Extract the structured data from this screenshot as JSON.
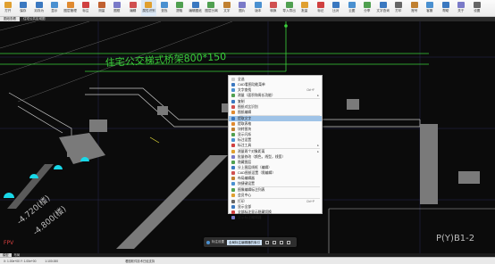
{
  "ribbon": {
    "buttons": [
      {
        "label": "打开",
        "icon": "open-folder-icon",
        "color": "#e0a030"
      },
      {
        "label": "保存",
        "icon": "save-icon",
        "color": "#3a78c0"
      },
      {
        "label": "另存为",
        "icon": "save-as-icon",
        "color": "#3a78c0"
      },
      {
        "label": "显示",
        "icon": "display-icon",
        "color": "#4a90d0"
      },
      {
        "label": "图层管理",
        "icon": "layer-icon",
        "color": "#e08a30"
      },
      {
        "label": "标注",
        "icon": "dimension-icon",
        "color": "#d04040"
      },
      {
        "label": "测量",
        "icon": "measure-icon",
        "color": "#c06030"
      },
      {
        "label": "图框",
        "icon": "frame-icon",
        "color": "#7a7ac8"
      },
      {
        "label": "编辑",
        "icon": "edit-icon",
        "color": "#d05050"
      },
      {
        "label": "属性识别",
        "icon": "property-icon",
        "color": "#e0a030"
      },
      {
        "label": "查找",
        "icon": "find-icon",
        "color": "#4a90d0"
      },
      {
        "label": "提取",
        "icon": "extract-icon",
        "color": "#50a050"
      },
      {
        "label": "编辑图纸",
        "icon": "edit-drawing-icon",
        "color": "#3a78c0"
      },
      {
        "label": "图层分离",
        "icon": "layer-split-icon",
        "color": "#50a050"
      },
      {
        "label": "文字",
        "icon": "text-icon",
        "color": "#c08030"
      },
      {
        "label": "图片",
        "icon": "image-icon",
        "color": "#7a7ac8"
      },
      {
        "label": "版本",
        "icon": "version-icon",
        "color": "#4a90d0"
      },
      {
        "label": "转换",
        "icon": "convert-icon",
        "color": "#d05050"
      },
      {
        "label": "导入导出",
        "icon": "import-export-icon",
        "color": "#50a050"
      },
      {
        "label": "批量",
        "icon": "batch-icon",
        "color": "#e0a030"
      },
      {
        "label": "标记",
        "icon": "mark-icon",
        "color": "#d04040"
      },
      {
        "label": "比对",
        "icon": "compare-icon",
        "color": "#3a78c0"
      },
      {
        "label": "云图",
        "icon": "cloud-icon",
        "color": "#4a90d0"
      },
      {
        "label": "分享",
        "icon": "share-icon",
        "color": "#50a050"
      },
      {
        "label": "文字查询",
        "icon": "text-search-icon",
        "color": "#3a78c0"
      },
      {
        "label": "打印",
        "icon": "print-icon",
        "color": "#666666"
      },
      {
        "label": "账号",
        "icon": "account-icon",
        "color": "#c08030"
      },
      {
        "label": "客服",
        "icon": "support-icon",
        "color": "#4a90d0"
      },
      {
        "label": "帮助",
        "icon": "help-icon",
        "color": "#3a78c0"
      },
      {
        "label": "关于",
        "icon": "about-icon",
        "color": "#7a7ac8"
      },
      {
        "label": "设置",
        "icon": "settings-icon",
        "color": "#666666"
      }
    ]
  },
  "tabs": [
    "图纸查看",
    "住宅公共区域图"
  ],
  "canvas": {
    "beam_label": "住宅公交梯式桥架800*150",
    "elevation_1": "-4.720(楼)",
    "elevation_2": "-4.800(楼)",
    "axis_label": "P(Y)B1-2",
    "bottom_text": "FPV"
  },
  "context_menu": {
    "items": [
      {
        "label": "全选",
        "shortcut": "",
        "icon_color": "#cccccc",
        "submenu": false
      },
      {
        "label": "CAD看图功能菜单",
        "shortcut": "",
        "icon_color": "#3a78c0",
        "submenu": false
      },
      {
        "label": "文字查找",
        "shortcut": "Ctrl+F",
        "icon_color": "#4a90d0",
        "submenu": false
      },
      {
        "label": "测量（面积和周长功能）",
        "shortcut": "",
        "icon_color": "#50a050",
        "submenu": true
      },
      {
        "label": "复制",
        "shortcut": "",
        "icon_color": "#3a78c0",
        "submenu": false
      },
      {
        "label": "图纸对比识别",
        "shortcut": "",
        "icon_color": "#d05050",
        "submenu": false
      },
      {
        "label": "图纸编辑",
        "shortcut": "",
        "icon_color": "#e08a30",
        "submenu": false
      },
      {
        "label": "提取文字",
        "shortcut": "",
        "icon_color": "#3a78c0",
        "submenu": false,
        "highlighted": true
      },
      {
        "label": "提取表格",
        "shortcut": "",
        "icon_color": "#e08a30",
        "submenu": false
      },
      {
        "label": "块转图块",
        "shortcut": "",
        "icon_color": "#c08030",
        "submenu": false
      },
      {
        "label": "显示闪烁",
        "shortcut": "",
        "icon_color": "#50a050",
        "submenu": false
      },
      {
        "label": "标注设置",
        "shortcut": "",
        "icon_color": "#4a90d0",
        "submenu": false
      },
      {
        "label": "标注工具",
        "shortcut": "",
        "icon_color": "#d04040",
        "submenu": true
      },
      {
        "label": "测量两个对象距离",
        "shortcut": "",
        "icon_color": "#e0a030",
        "submenu": true
      },
      {
        "label": "批量修改（颜色，线型，线宽）",
        "shortcut": "",
        "icon_color": "#7a7ac8",
        "submenu": false
      },
      {
        "label": "隐藏图层",
        "shortcut": "",
        "icon_color": "#50a050",
        "submenu": false
      },
      {
        "label": "分上图层线框（编辑）",
        "shortcut": "",
        "icon_color": "#3a78c0",
        "submenu": false
      },
      {
        "label": "CAD图纸设置（需编辑）",
        "shortcut": "",
        "icon_color": "#d05050",
        "submenu": false
      },
      {
        "label": "布局编辑器",
        "shortcut": "",
        "icon_color": "#c08030",
        "submenu": false
      },
      {
        "label": "快捷键设置",
        "shortcut": "",
        "icon_color": "#4a90d0",
        "submenu": false
      },
      {
        "label": "图像编辑标注列表",
        "shortcut": "",
        "icon_color": "#50a050",
        "submenu": false,
        "checked": true
      },
      {
        "label": "会员中心",
        "shortcut": "",
        "icon_color": "#e0a030",
        "submenu": false
      },
      {
        "label": "打印",
        "shortcut": "Ctrl+P",
        "icon_color": "#666666",
        "submenu": false
      },
      {
        "label": "显示全部",
        "shortcut": "",
        "icon_color": "#3a78c0",
        "submenu": false
      },
      {
        "label": "全部标注显示隐藏切换",
        "shortcut": "",
        "icon_color": "#d04040",
        "submenu": false
      },
      {
        "label": "显示标注编辑器",
        "shortcut": "",
        "icon_color": "#7a7ac8",
        "submenu": false
      }
    ],
    "separators_after": [
      3,
      6,
      12,
      19,
      21
    ]
  },
  "floatbar": {
    "label": "标注设置",
    "dropdown": "全局标注编辑器的索引"
  },
  "model_tabs": [
    "模型",
    "布局"
  ],
  "status": {
    "coords": "X: 1.00e+00  Y: 1.00e+00",
    "scale": "1:100.000",
    "message": "看图软件技术已经支持"
  }
}
